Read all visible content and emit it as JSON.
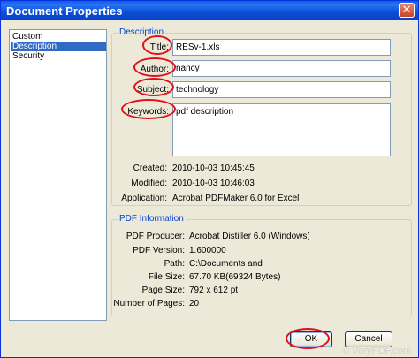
{
  "window": {
    "title": "Document Properties",
    "close_glyph": "✕"
  },
  "sidebar": {
    "items": [
      {
        "label": "Custom",
        "selected": false
      },
      {
        "label": "Description",
        "selected": true
      },
      {
        "label": "Security",
        "selected": false
      }
    ]
  },
  "description": {
    "legend": "Description",
    "title_label": "Title:",
    "title_value": "RESv-1.xls",
    "author_label": "Author:",
    "author_value": "nancy",
    "subject_label": "Subject:",
    "subject_value": "technology",
    "keywords_label": "Keywords:",
    "keywords_value": "pdf description",
    "created_label": "Created:",
    "created_value": "2010-10-03 10:45:45",
    "modified_label": "Modified:",
    "modified_value": "2010-10-03 10:46:03",
    "application_label": "Application:",
    "application_value": "Acrobat PDFMaker 6.0 for Excel"
  },
  "pdf_info": {
    "legend": "PDF Information",
    "rows": [
      {
        "label": "PDF Producer:",
        "value": "Acrobat Distiller 6.0 (Windows)"
      },
      {
        "label": "PDF Version:",
        "value": "1.600000"
      },
      {
        "label": "Path:",
        "value": "C:\\Documents and"
      },
      {
        "label": "File Size:",
        "value": "67.70 KB(69324 Bytes)"
      },
      {
        "label": "Page Size:",
        "value": "792 x 612 pt"
      },
      {
        "label": "Number of Pages:",
        "value": "20"
      }
    ]
  },
  "buttons": {
    "ok_label": "OK",
    "cancel_label": "Cancel"
  },
  "watermark": "© VeryPDF.com",
  "colors": {
    "title_bar": "#0a4fd6",
    "selection": "#316ac5",
    "annotation": "#e0101a",
    "legend_text": "#0046d5"
  }
}
